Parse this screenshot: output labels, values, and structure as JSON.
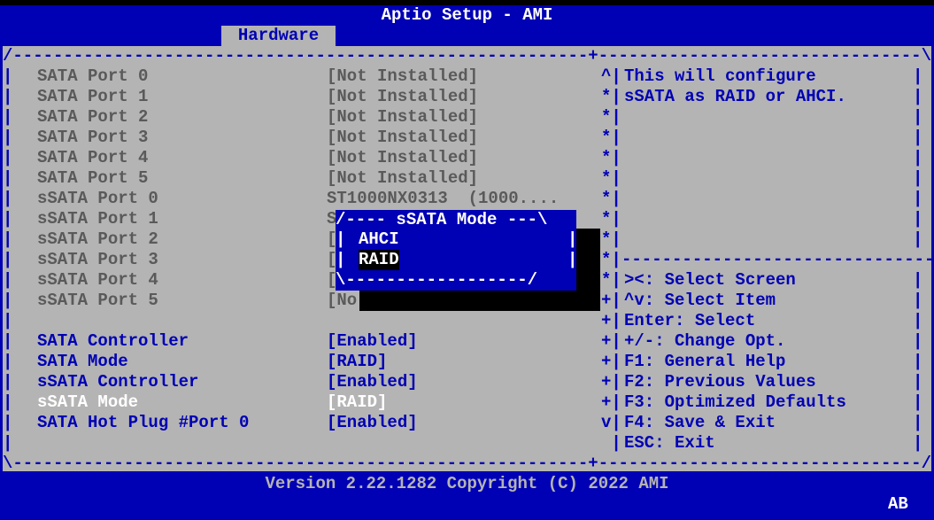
{
  "app": {
    "title": "Aptio Setup - AMI",
    "tab": "Hardware"
  },
  "frame": {
    "top": "/---------------------------------------------------------+--------------------------------\\",
    "bottom": "\\---------------------------------------------------------+--------------------------------/",
    "help_divider": "---------------------------------"
  },
  "settings": [
    {
      "label": "SATA Port 0",
      "value": "[Not Installed]",
      "scroll": "^|",
      "style": "gray"
    },
    {
      "label": "SATA Port 1",
      "value": "[Not Installed]",
      "scroll": "*|",
      "style": "gray"
    },
    {
      "label": "SATA Port 2",
      "value": "[Not Installed]",
      "scroll": "*|",
      "style": "gray"
    },
    {
      "label": "SATA Port 3",
      "value": "[Not Installed]",
      "scroll": "*|",
      "style": "gray"
    },
    {
      "label": "SATA Port 4",
      "value": "[Not Installed]",
      "scroll": "*|",
      "style": "gray"
    },
    {
      "label": "SATA Port 5",
      "value": "[Not Installed]",
      "scroll": "*|",
      "style": "gray"
    },
    {
      "label": "sSATA Port 0",
      "value": "ST1000NX0313  (1000....",
      "scroll": "*|",
      "style": "gray"
    },
    {
      "label": "sSATA Port 1",
      "value": "S",
      "scroll": "*|",
      "style": "gray"
    },
    {
      "label": "sSATA Port 2",
      "value": "[",
      "scroll": "*|",
      "style": "gray"
    },
    {
      "label": "sSATA Port 3",
      "value": "[",
      "scroll": "*|",
      "style": "gray"
    },
    {
      "label": "sSATA Port 4",
      "value": "[",
      "scroll": "*|",
      "style": "gray"
    },
    {
      "label": "sSATA Port 5",
      "value": "[No",
      "scroll": "+|",
      "style": "gray"
    },
    {
      "label": "",
      "value": "",
      "scroll": "+|",
      "style": "blue"
    },
    {
      "label": "SATA Controller",
      "value": "[Enabled]",
      "scroll": "+|",
      "style": "blue"
    },
    {
      "label": "SATA Mode",
      "value": "[RAID]",
      "scroll": "+|",
      "style": "blue"
    },
    {
      "label": "sSATA Controller",
      "value": "[Enabled]",
      "scroll": "+|",
      "style": "blue"
    },
    {
      "label": "sSATA Mode",
      "value": "[RAID]",
      "scroll": "+|",
      "style": "white"
    },
    {
      "label": "SATA Hot Plug #Port 0",
      "value": "[Enabled]",
      "scroll": "v|",
      "style": "blue"
    },
    {
      "label": "",
      "value": "",
      "scroll": " |",
      "style": "blue"
    }
  ],
  "help": {
    "lines": [
      "This will configure",
      "sSATA as RAID or AHCI."
    ]
  },
  "keys": [
    "><: Select Screen",
    "^v: Select Item",
    "Enter: Select",
    "+/-: Change Opt.",
    "F1: General Help",
    "F2: Previous Values",
    "F3: Optimized Defaults",
    "F4: Save & Exit",
    "ESC: Exit"
  ],
  "popup": {
    "title": "/---- sSATA Mode ---\\",
    "bottom": "\\------------------/",
    "options": [
      {
        "label": "AHCI",
        "selected": false
      },
      {
        "label": "RAID",
        "selected": true
      }
    ]
  },
  "footer": {
    "version": "Version 2.22.1282 Copyright (C) 2022 AMI",
    "badge": "AB"
  },
  "colors": {
    "background": "#0000b4",
    "panel": "#b4b4b4",
    "highlight": "#ffffff",
    "disabled": "#5a5a5a"
  }
}
